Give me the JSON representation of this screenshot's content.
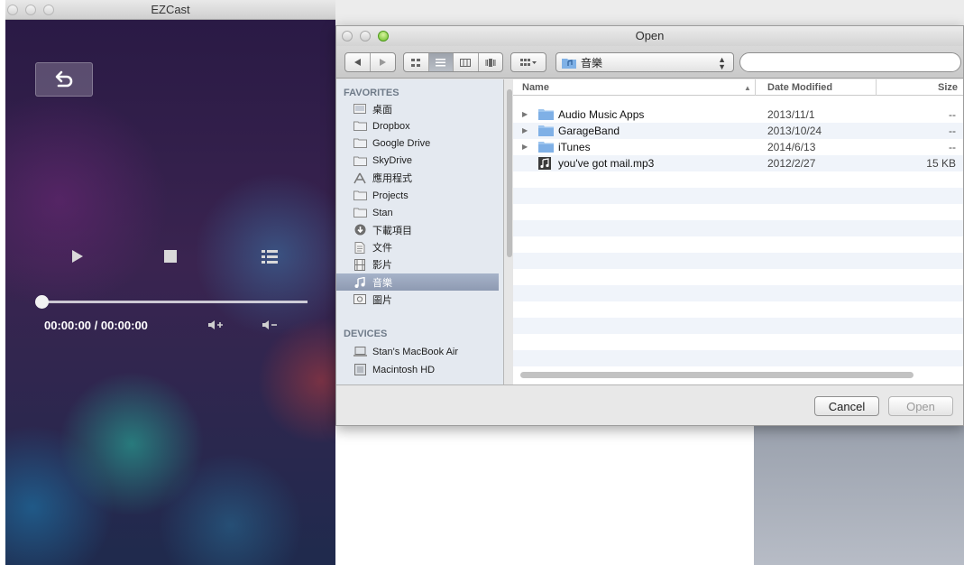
{
  "ezcast": {
    "title": "EZCast",
    "time_display": "00:00:00 / 00:00:00",
    "progress": 0
  },
  "dialog": {
    "title": "Open",
    "path_popup": "音樂",
    "search": {
      "value": "",
      "placeholder": ""
    },
    "sidebar": {
      "favorites_header": "FAVORITES",
      "favorites": [
        {
          "label": "桌面",
          "icon": "desktop-icon"
        },
        {
          "label": "Dropbox",
          "icon": "folder-icon"
        },
        {
          "label": "Google Drive",
          "icon": "folder-icon"
        },
        {
          "label": "SkyDrive",
          "icon": "folder-icon"
        },
        {
          "label": "應用程式",
          "icon": "applications-icon"
        },
        {
          "label": "Projects",
          "icon": "folder-icon"
        },
        {
          "label": "Stan",
          "icon": "folder-icon"
        },
        {
          "label": "下載項目",
          "icon": "download-icon"
        },
        {
          "label": "文件",
          "icon": "documents-icon"
        },
        {
          "label": "影片",
          "icon": "movies-icon"
        },
        {
          "label": "音樂",
          "icon": "music-icon",
          "selected": true
        },
        {
          "label": "圖片",
          "icon": "pictures-icon"
        }
      ],
      "devices_header": "DEVICES",
      "devices": [
        {
          "label": "Stan's MacBook Air",
          "icon": "laptop-icon"
        },
        {
          "label": "Macintosh HD",
          "icon": "disk-icon"
        }
      ]
    },
    "columns": {
      "name": "Name",
      "date": "Date Modified",
      "size": "Size"
    },
    "files": [
      {
        "name": "Audio Music Apps",
        "date": "2013/11/1",
        "size": "--",
        "type": "folder"
      },
      {
        "name": "GarageBand",
        "date": "2013/10/24",
        "size": "--",
        "type": "folder"
      },
      {
        "name": "iTunes",
        "date": "2014/6/13",
        "size": "--",
        "type": "folder"
      },
      {
        "name": "you've got mail.mp3",
        "date": "2012/2/27",
        "size": "15 KB",
        "type": "audio"
      }
    ],
    "buttons": {
      "cancel": "Cancel",
      "open": "Open"
    }
  }
}
